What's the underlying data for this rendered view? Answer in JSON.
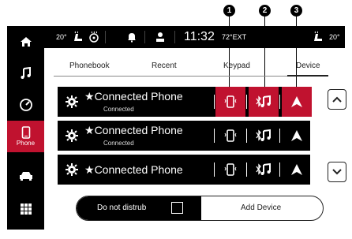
{
  "callouts": [
    "1",
    "2",
    "3"
  ],
  "status_bar": {
    "left_temp": "20°",
    "time": "11:32",
    "outside_temp": "72°EXT",
    "right_temp": "20°"
  },
  "sidebar": {
    "items": [
      {
        "name": "home",
        "label": ""
      },
      {
        "name": "media",
        "label": ""
      },
      {
        "name": "controls",
        "label": ""
      },
      {
        "name": "phone",
        "label": "Phone"
      },
      {
        "name": "vehicle",
        "label": ""
      },
      {
        "name": "apps",
        "label": ""
      }
    ]
  },
  "tabs": [
    "Phonebook",
    "Recent",
    "Keypad",
    "Device"
  ],
  "active_tab": "Device",
  "devices": [
    {
      "name": "Connected Phone",
      "status": "Connected"
    },
    {
      "name": "Connected Phone",
      "status": "Connected"
    },
    {
      "name": "Connected Phone",
      "status": ""
    }
  ],
  "bottom_bar": {
    "do_not_disturb_label": "Do not distrub",
    "add_device_label": "Add Device"
  },
  "colors": {
    "accent": "#c0122f",
    "bar": "#000000"
  }
}
